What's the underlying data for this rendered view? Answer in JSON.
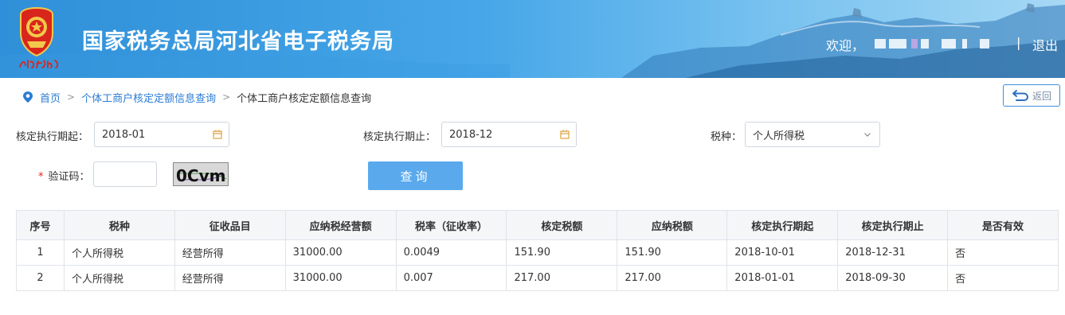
{
  "header": {
    "title": "国家税务总局河北省电子税务局",
    "emblem_script": "中国税务",
    "welcome": "欢迎，",
    "separator": "|",
    "logout": "退出"
  },
  "breadcrumb": {
    "home": "首页",
    "level1": "个体工商户核定定额信息查询",
    "current": "个体工商户核定定额信息查询",
    "gt": ">"
  },
  "back_button": {
    "label": "返回"
  },
  "form": {
    "start_label": "核定执行期起：",
    "start_value": "2018-01",
    "end_label": "核定执行期止：",
    "end_value": "2018-12",
    "tax_label": "税种：",
    "tax_value": "个人所得税",
    "captcha_label": "验证码：",
    "required_mark": "*",
    "captcha_value": "",
    "captcha_text": "0Cvm",
    "query_button": "查询"
  },
  "table": {
    "headers": [
      "序号",
      "税种",
      "征收品目",
      "应纳税经营额",
      "税率（征收率）",
      "核定税额",
      "应纳税额",
      "核定执行期起",
      "核定执行期止",
      "是否有效"
    ],
    "rows": [
      [
        "1",
        "个人所得税",
        "经营所得",
        "31000.00",
        "0.0049",
        "151.90",
        "151.90",
        "2018-10-01",
        "2018-12-31",
        "否"
      ],
      [
        "2",
        "个人所得税",
        "经营所得",
        "31000.00",
        "0.007",
        "217.00",
        "217.00",
        "2018-01-01",
        "2018-09-30",
        "否"
      ]
    ]
  },
  "colors": {
    "header_blue": "#2f8fd8",
    "link_blue": "#2b7bd4",
    "button_blue": "#5aa9ec",
    "required_red": "#e02020"
  }
}
